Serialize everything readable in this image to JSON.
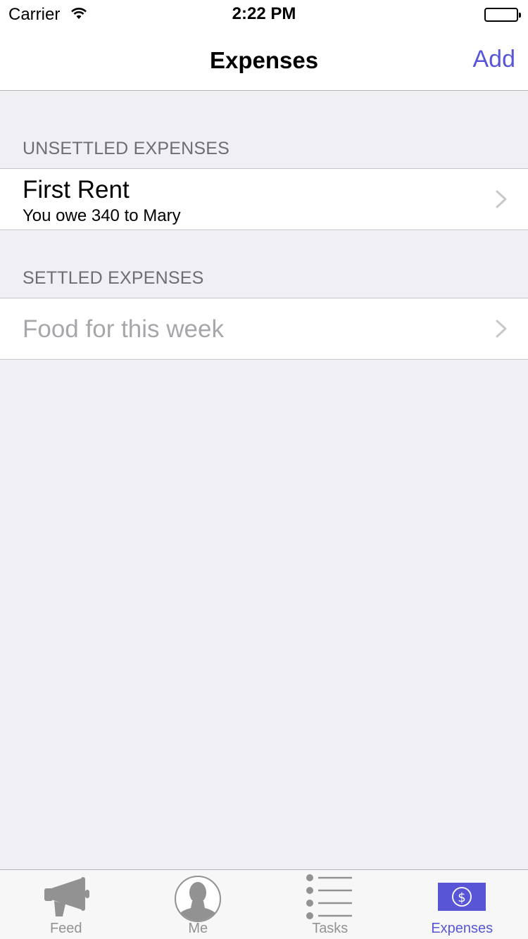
{
  "status_bar": {
    "carrier": "Carrier",
    "time": "2:22 PM"
  },
  "nav": {
    "title": "Expenses",
    "add_label": "Add"
  },
  "sections": {
    "unsettled": {
      "header": "UNSETTLED EXPENSES",
      "items": [
        {
          "title": "First Rent",
          "subtitle": "You owe 340 to Mary"
        }
      ]
    },
    "settled": {
      "header": "SETTLED EXPENSES",
      "items": [
        {
          "title": "Food for this week"
        }
      ]
    }
  },
  "tab_bar": {
    "tabs": [
      {
        "label": "Feed",
        "icon": "megaphone-icon"
      },
      {
        "label": "Me",
        "icon": "person-icon"
      },
      {
        "label": "Tasks",
        "icon": "list-icon"
      },
      {
        "label": "Expenses",
        "icon": "dollar-icon",
        "active": true
      }
    ]
  },
  "colors": {
    "accent": "#5856d6",
    "background": "#efeff4",
    "inactive_tab": "#929292"
  }
}
